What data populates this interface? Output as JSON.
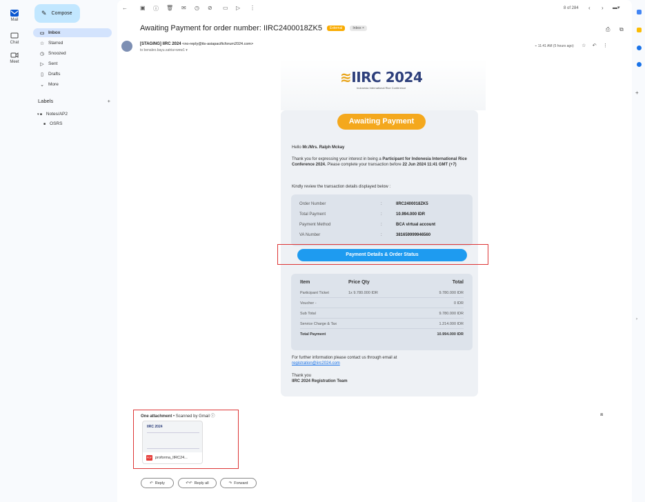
{
  "rail": {
    "mail": "Mail",
    "chat": "Chat",
    "meet": "Meet"
  },
  "sidebar": {
    "compose": "Compose",
    "items": [
      {
        "label": "Inbox",
        "icon": "inbox-icon"
      },
      {
        "label": "Starred",
        "icon": "star-icon"
      },
      {
        "label": "Snoozed",
        "icon": "clock-icon"
      },
      {
        "label": "Sent",
        "icon": "send-icon"
      },
      {
        "label": "Drafts",
        "icon": "draft-icon"
      },
      {
        "label": "More",
        "icon": "chevron-down-icon"
      }
    ],
    "labels_title": "Labels",
    "labels": [
      "Notes/AP2",
      "OSRS"
    ]
  },
  "toolbar": {
    "pagination": "8 of 284"
  },
  "message": {
    "subject": "Awaiting Payment for order number: IIRC2400018ZK5",
    "external_chip": "External",
    "inbox_chip": "Inbox ×",
    "sender_name": "[STAGING] IIRC 2024",
    "sender_email": "<no-reply@its-asiapacificforum2024.com>",
    "to": "to benaleo.bayu.satria+wew1 ▾",
    "time": "11:41 AM (5 hours ago)"
  },
  "email": {
    "logo_main": "IIRC 2024",
    "logo_sub": "Indonesia International Rice Conference",
    "awaiting_label": "Awaiting Payment",
    "greeting_prefix": "Hello",
    "greeting_name": "Mr./Mrs. Ralph Mckay",
    "intro_1": "Thank you for expressing your interest in being a",
    "intro_bold": "Participant for Indonesia International Rice Conference 2024.",
    "intro_2": "Please complete your transaction before",
    "deadline": "22 Jun 2024 11:41 GMT (+7)",
    "review": "Kindly review the transaction details displayed below :",
    "order_details": [
      {
        "key": "Order Number",
        "value": "IIRC2400018ZK5"
      },
      {
        "key": "Total Payment",
        "value": "10.994.000 IDR"
      },
      {
        "key": "Payment Method",
        "value": "BCA virtual account"
      },
      {
        "key": "VA Number",
        "value": "381659999946560"
      }
    ],
    "pay_button": "Payment Details & Order Status",
    "items_header": {
      "item": "Item",
      "price_qty": "Price Qty",
      "total": "Total"
    },
    "items": [
      {
        "name": "Participant Ticket",
        "price_qty": "1x 9.780.000 IDR",
        "total": "9.780.000 IDR"
      },
      {
        "name": "Voucher -",
        "price_qty": "",
        "total": "0 IDR"
      },
      {
        "name": "Sub Total",
        "price_qty": "",
        "total": "9.780.000 IDR"
      },
      {
        "name": "Service Charge & Tax",
        "price_qty": "",
        "total": "1.214.000 IDR"
      },
      {
        "name": "Total Payment",
        "price_qty": "",
        "total": "10.994.000 IDR"
      }
    ],
    "further_info": "For further information please contact us through email at",
    "contact_email": "registration@iirc2024.com",
    "thanks": "Thank you",
    "team": "IIRC 2024 Registration Team"
  },
  "attachment": {
    "title": "One attachment",
    "scanned": "• Scanned by Gmail",
    "filename": "proforma_IIRC24...",
    "pdf": "PDF"
  },
  "actions": {
    "reply": "Reply",
    "reply_all": "Reply all",
    "forward": "Forward"
  },
  "colors": {
    "accent_orange": "#f4a81d",
    "accent_blue": "#1e9bf0",
    "inbox_selected": "#d3e3fd",
    "compose": "#c2e7ff",
    "annotation_red": "#dd3333"
  }
}
